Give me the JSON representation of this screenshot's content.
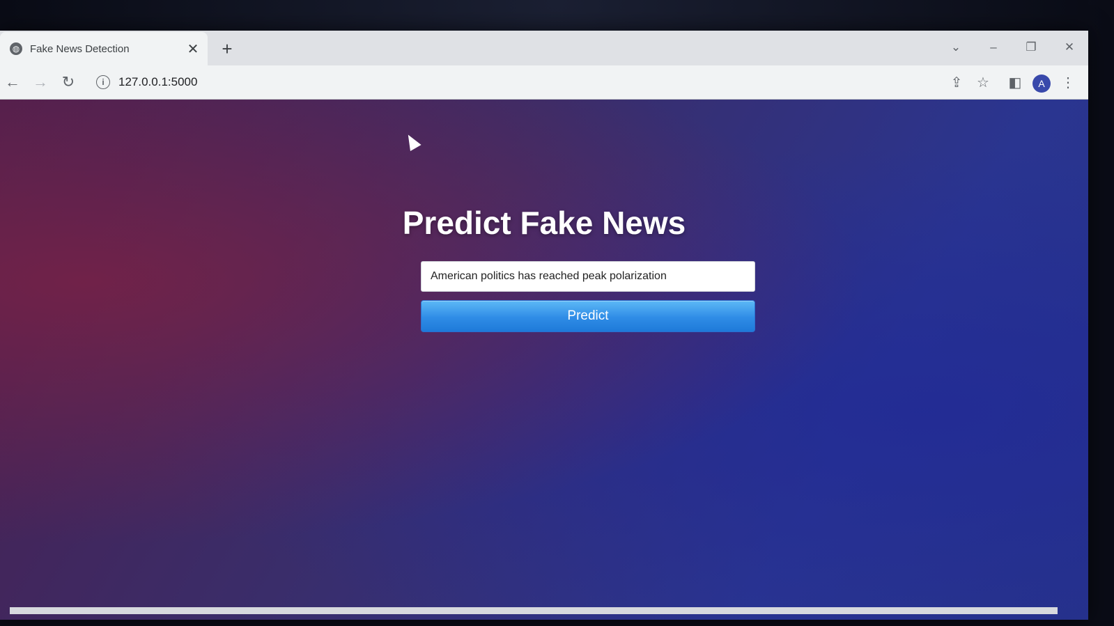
{
  "browser": {
    "tab": {
      "title": "Fake News Detection",
      "favicon": "globe-icon",
      "close_glyph": "✕"
    },
    "new_tab_glyph": "+",
    "window_controls": {
      "tab_search": "⌄",
      "minimize": "–",
      "restore": "❐",
      "close": "✕"
    },
    "nav": {
      "back": "←",
      "forward": "→",
      "reload": "↻"
    },
    "address": {
      "info_glyph": "i",
      "url": "127.0.0.1:5000"
    },
    "toolbar_icons": {
      "share": "⇪",
      "bookmark": "☆",
      "side_panel": "◧",
      "menu": "⋮"
    },
    "profile_initial": "A"
  },
  "page": {
    "heading": "Predict Fake News",
    "input_value": "American politics has reached peak polarization",
    "predict_label": "Predict"
  },
  "colors": {
    "button_accent": "#2f8ce6",
    "background_left": "#4a1f4e",
    "background_right": "#26328a"
  }
}
